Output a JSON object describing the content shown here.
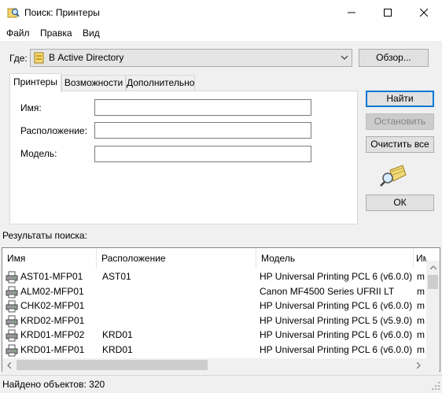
{
  "window": {
    "title": "Поиск: Принтеры"
  },
  "menu": {
    "file": "Файл",
    "edit": "Правка",
    "view": "Вид"
  },
  "where": {
    "label": "Где:",
    "value": "В Active Directory",
    "browse_button": "Обзор..."
  },
  "tabs": [
    "Принтеры",
    "Возможности",
    "Дополнительно"
  ],
  "fields": {
    "name_label": "Имя:",
    "location_label": "Расположение:",
    "model_label": "Модель:",
    "name_value": "",
    "location_value": "",
    "model_value": ""
  },
  "buttons": {
    "find": "Найти",
    "stop": "Остановить",
    "clear_all": "Очистить все",
    "ok": "ОК"
  },
  "results": {
    "label": "Результаты поиска:",
    "columns": [
      "Имя",
      "Расположение",
      "Модель",
      "Им"
    ],
    "rows": [
      {
        "name": "AST01-MFP01",
        "location": "AST01",
        "model": "HP Universal Printing PCL 6 (v6.0.0)",
        "extra": "m"
      },
      {
        "name": "ALM02-MFP01",
        "location": "",
        "model": "Canon MF4500 Series UFRII LT",
        "extra": "m"
      },
      {
        "name": "CHK02-MFP01",
        "location": "",
        "model": "HP Universal Printing PCL 6 (v6.0.0)",
        "extra": "m"
      },
      {
        "name": "KRD02-MFP01",
        "location": "",
        "model": "HP Universal Printing PCL 5 (v5.9.0)",
        "extra": "m"
      },
      {
        "name": "KRD01-MFP02",
        "location": "KRD01",
        "model": "HP Universal Printing PCL 6 (v6.0.0)",
        "extra": "m"
      },
      {
        "name": "KRD01-MFP01",
        "location": "KRD01",
        "model": "HP Universal Printing PCL 6 (v6.0.0)",
        "extra": "m"
      }
    ]
  },
  "status": {
    "text": "Найдено объектов: 320"
  },
  "icons": {
    "window": "search-folder-icon",
    "location": "directory-icon",
    "search_illustration": "magnifier-icon",
    "row": "printer-icon"
  }
}
